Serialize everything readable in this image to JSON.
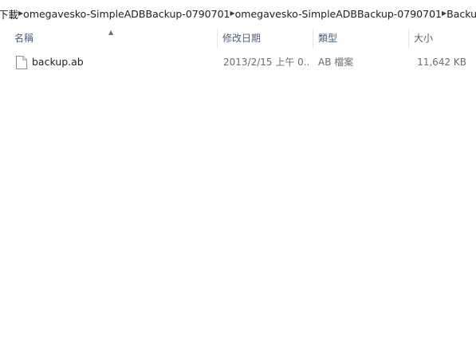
{
  "breadcrumb": {
    "items": [
      "下載",
      "omegavesko-SimpleADBBackup-0790701",
      "omegavesko-SimpleADBBackup-0790701",
      "Backup"
    ]
  },
  "columns": {
    "name": "名稱",
    "date": "修改日期",
    "type": "類型",
    "size": "大小",
    "sorted_by": "name",
    "sort_direction": "ascending"
  },
  "files": [
    {
      "name": "backup.ab",
      "date": "2013/2/15 上午 0...",
      "type": "AB 檔案",
      "size": "11,642 KB",
      "icon": "generic-file-icon"
    }
  ],
  "colors": {
    "header_text": "#4c607a",
    "detail_text": "#6d6d6d",
    "name_text": "#1e1e1e"
  }
}
